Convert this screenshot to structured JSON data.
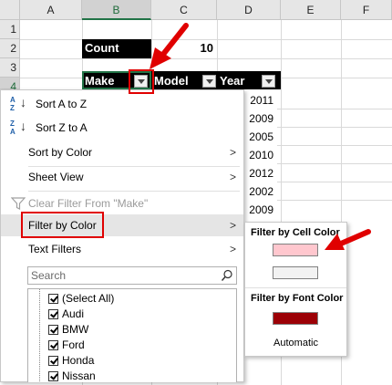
{
  "sheet": {
    "columns": [
      "A",
      "B",
      "C",
      "D",
      "E",
      "F"
    ],
    "rows": [
      "1",
      "2",
      "3",
      "4"
    ],
    "count_label": "Count",
    "count_value": "10",
    "headers": {
      "make": "Make",
      "model": "Model",
      "year": "Year"
    },
    "years": [
      "2011",
      "2009",
      "2005",
      "2010",
      "2012",
      "2002",
      "2009"
    ]
  },
  "menu": {
    "sort_az": "Sort A to Z",
    "sort_za": "Sort Z to A",
    "sort_by_color": "Sort by Color",
    "sheet_view": "Sheet View",
    "clear_filter": "Clear Filter From \"Make\"",
    "filter_by_color": "Filter by Color",
    "text_filters": "Text Filters",
    "search_placeholder": "Search",
    "items": [
      "(Select All)",
      "Audi",
      "BMW",
      "Ford",
      "Honda",
      "Nissan"
    ],
    "az_glyph_top": "A",
    "az_glyph_bottom": "Z",
    "za_glyph_top": "Z",
    "za_glyph_bottom": "A"
  },
  "submenu": {
    "cell_color_title": "Filter by Cell Color",
    "font_color_title": "Filter by Font Color",
    "automatic": "Automatic",
    "cell_colors": [
      "#ffc7ce",
      "#f2f2f2"
    ],
    "font_colors": [
      "#9c0006"
    ]
  },
  "colors": {
    "highlight": "#e00000",
    "excel_green": "#217346"
  }
}
